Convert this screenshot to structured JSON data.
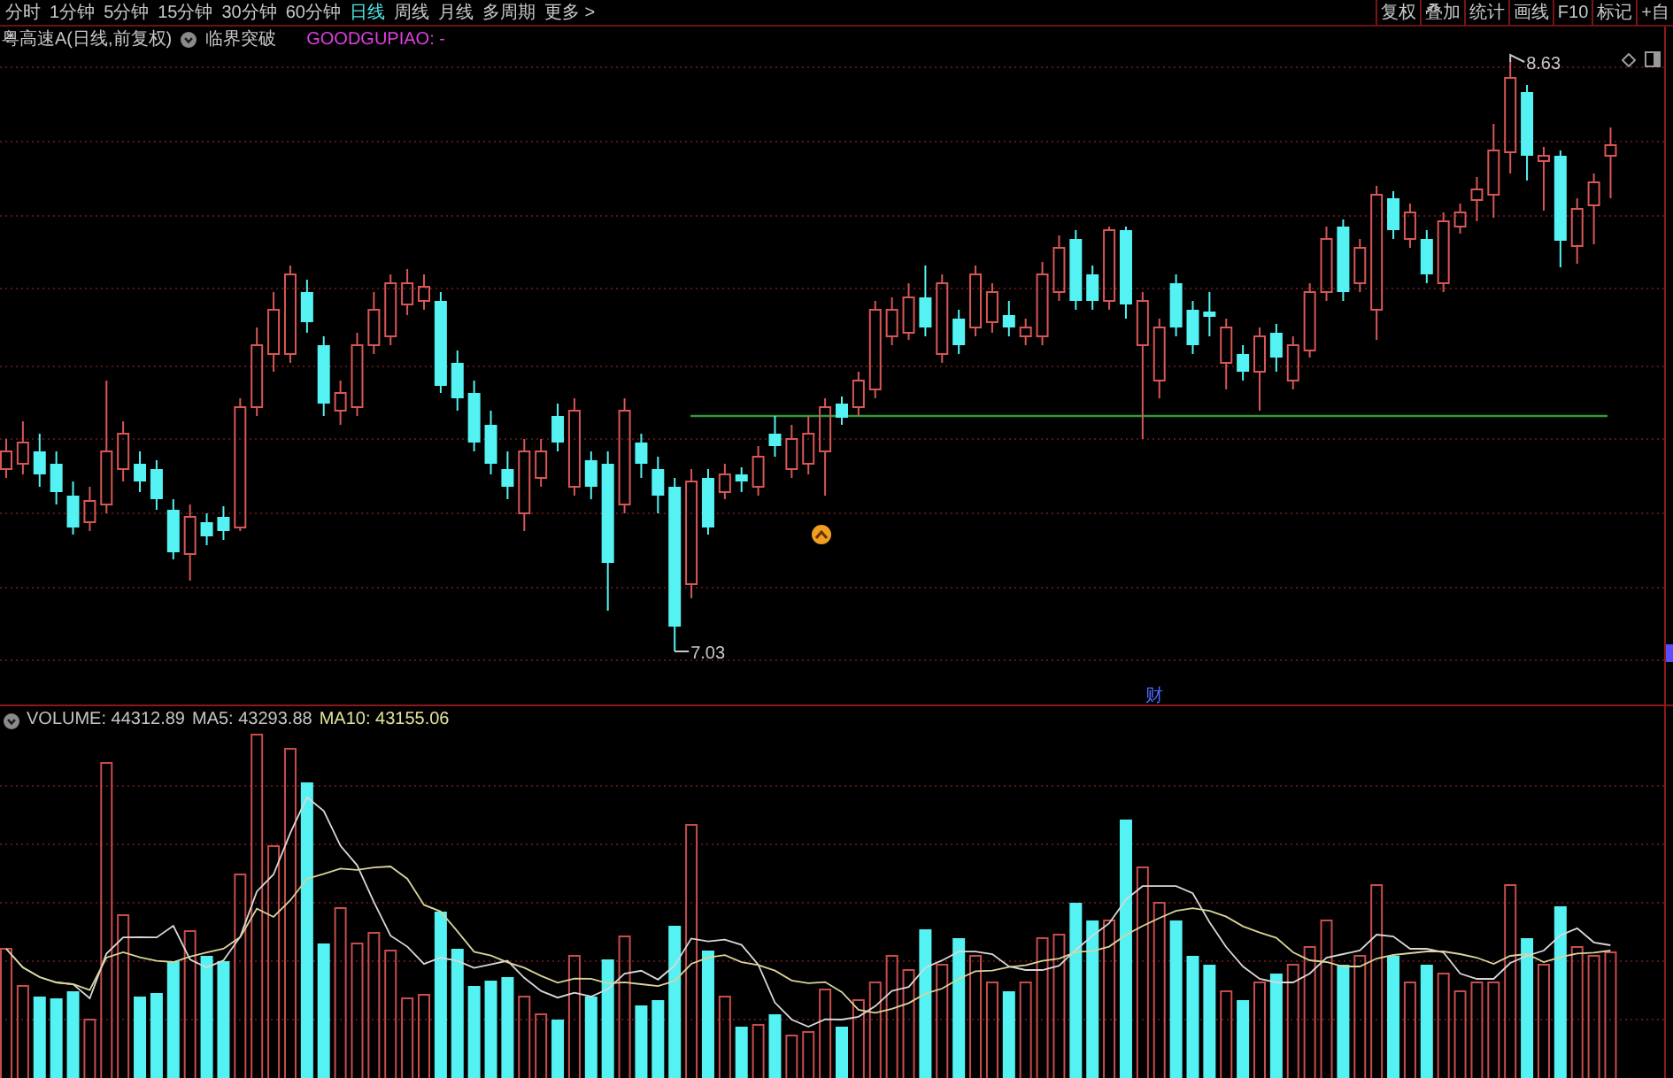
{
  "toolbar": {
    "tabs": [
      {
        "label": "分时",
        "selected": false
      },
      {
        "label": "1分钟",
        "selected": false
      },
      {
        "label": "5分钟",
        "selected": false
      },
      {
        "label": "15分钟",
        "selected": false
      },
      {
        "label": "30分钟",
        "selected": false
      },
      {
        "label": "60分钟",
        "selected": false
      },
      {
        "label": "日线",
        "selected": true
      },
      {
        "label": "周线",
        "selected": false
      },
      {
        "label": "月线",
        "selected": false
      },
      {
        "label": "多周期",
        "selected": false
      },
      {
        "label": "更多 >",
        "selected": false
      }
    ],
    "buttons": [
      "复权",
      "叠加",
      "统计",
      "画线",
      "F10",
      "标记",
      "+自"
    ]
  },
  "price_chart": {
    "title": "粤高速A(日线,前复权)",
    "indicator": "临界突破",
    "indicator_output": "GOODGUPIAO: -",
    "high_label": "8.63",
    "low_label": "7.03",
    "event_marker": "财"
  },
  "volume_chart": {
    "readings": [
      {
        "kind": "volume",
        "text": "VOLUME: 44312.89"
      },
      {
        "kind": "ma5",
        "text": "MA5: 43293.88"
      },
      {
        "kind": "ma10",
        "text": "MA10: 43155.06"
      }
    ]
  }
}
